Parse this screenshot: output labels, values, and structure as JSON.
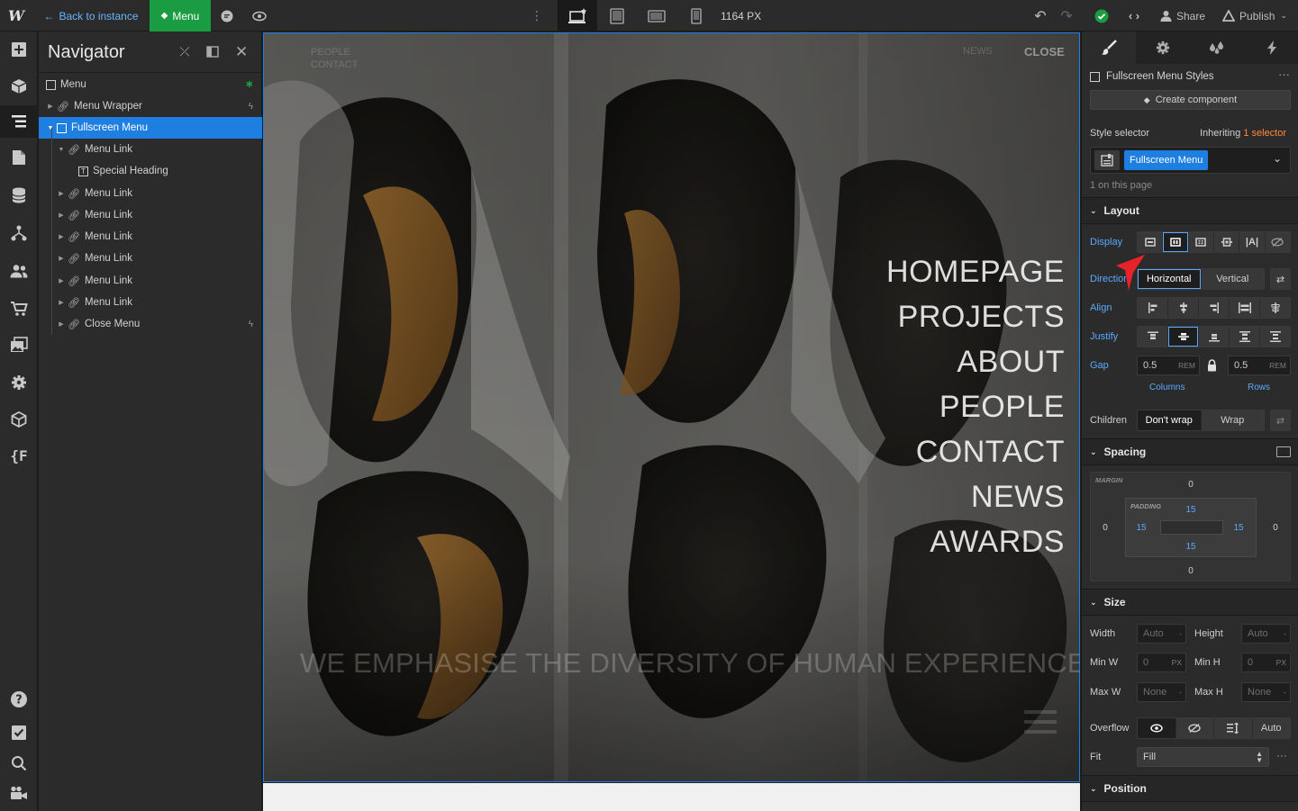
{
  "topbar": {
    "back_label": "Back to instance",
    "menu_label": "Menu",
    "width_value": "1164",
    "width_unit": "PX",
    "share_label": "Share",
    "publish_label": "Publish"
  },
  "navigator": {
    "title": "Navigator",
    "items": [
      {
        "label": "Menu"
      },
      {
        "label": "Menu Wrapper"
      },
      {
        "label": "Fullscreen Menu"
      },
      {
        "label": "Menu Link"
      },
      {
        "label": "Special Heading"
      },
      {
        "label": "Menu Link"
      },
      {
        "label": "Menu Link"
      },
      {
        "label": "Menu Link"
      },
      {
        "label": "Menu Link"
      },
      {
        "label": "Menu Link"
      },
      {
        "label": "Menu Link"
      },
      {
        "label": "Close Menu"
      }
    ]
  },
  "canvas": {
    "top_left": [
      "PEOPLE",
      "CONTACT"
    ],
    "top_right_news": "NEWS",
    "close_label": "CLOSE",
    "menu": [
      "HOMEPAGE",
      "PROJECTS",
      "ABOUT",
      "PEOPLE",
      "CONTACT",
      "NEWS",
      "AWARDS"
    ],
    "tagline": "WE EMPHASISE THE DIVERSITY OF HUMAN EXPERIENCE"
  },
  "style_panel": {
    "class_name": "Fullscreen Menu Styles",
    "create_component": "Create component",
    "selector_label": "Style selector",
    "inheriting_label": "Inheriting",
    "inheriting_count": "1 selector",
    "selector_chip": "Fullscreen Menu",
    "on_page": "1 on this page",
    "layout": {
      "title": "Layout",
      "display_label": "Display",
      "direction_label": "Direction",
      "direction_options": [
        "Horizontal",
        "Vertical"
      ],
      "align_label": "Align",
      "justify_label": "Justify",
      "gap_label": "Gap",
      "gap_columns": "0.5",
      "gap_rows": "0.5",
      "gap_unit": "REM",
      "columns_label": "Columns",
      "rows_label": "Rows",
      "children_label": "Children",
      "children_options": [
        "Don't wrap",
        "Wrap"
      ]
    },
    "spacing": {
      "title": "Spacing",
      "margin_label": "MARGIN",
      "padding_label": "PADDING",
      "margin_top": "0",
      "margin_bottom": "0",
      "margin_left": "0",
      "margin_right": "0",
      "padding_top": "15",
      "padding_bottom": "15",
      "padding_left": "15",
      "padding_right": "15"
    },
    "size": {
      "title": "Size",
      "width_label": "Width",
      "width_value": "Auto",
      "height_label": "Height",
      "height_value": "Auto",
      "minw_label": "Min W",
      "minw_value": "0",
      "minh_label": "Min H",
      "minh_value": "0",
      "maxw_label": "Max W",
      "maxw_value": "None",
      "maxh_label": "Max H",
      "maxh_value": "None",
      "unit_px": "PX",
      "unit_dash": "-",
      "overflow_label": "Overflow",
      "overflow_auto": "Auto",
      "fit_label": "Fit",
      "fit_value": "Fill"
    },
    "position": {
      "title": "Position"
    }
  },
  "colors": {
    "accent": "#1e7fe0",
    "green": "#1a9c42",
    "red_arrow": "#e8222a"
  }
}
